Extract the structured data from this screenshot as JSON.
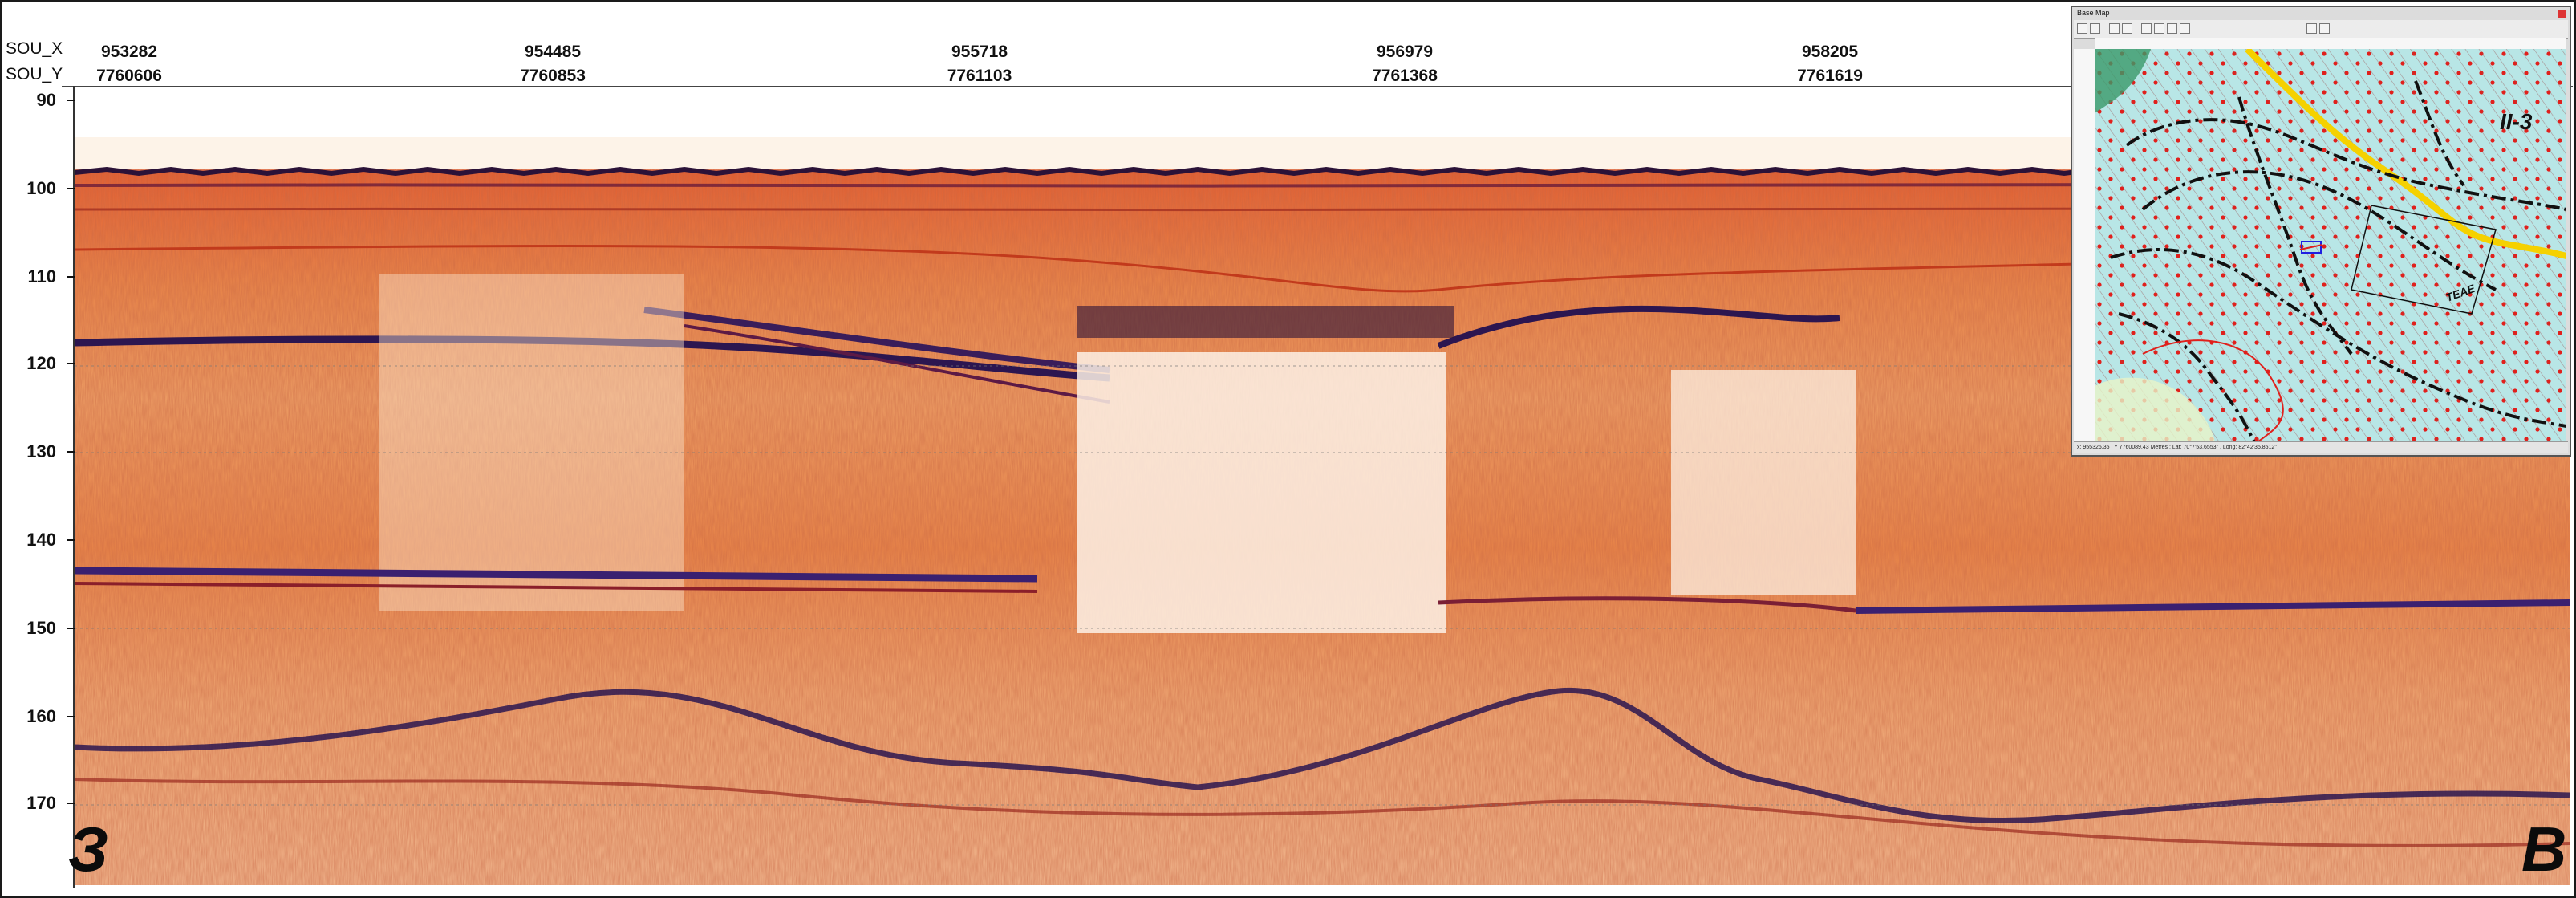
{
  "header": {
    "x_label": "SOU_X",
    "y_label": "SOU_Y",
    "coords": [
      {
        "x": "953282",
        "y": "7760606"
      },
      {
        "x": "954485",
        "y": "7760853"
      },
      {
        "x": "955718",
        "y": "7761103"
      },
      {
        "x": "956979",
        "y": "7761368"
      },
      {
        "x": "958205",
        "y": "7761619"
      }
    ]
  },
  "depth_axis": {
    "ticks": [
      "90",
      "100",
      "110",
      "120",
      "130",
      "140",
      "150",
      "160",
      "170"
    ]
  },
  "panel_labels": {
    "left": "З",
    "right": "В"
  },
  "inset": {
    "title": "Base Map",
    "map_label_1": "II-3",
    "map_label_2": "ТЕАЕ",
    "status": "x: 955326.35 , Y 7760089.43 Metres ; Lat: 70°7'53.6553\" , Long: 82°42'35.8512\""
  },
  "colors": {
    "seismic_light": "#fbe8d4",
    "seismic_mid": "#f08c3c",
    "seismic_dark": "#c2391b",
    "seismic_deep": "#3a1d5a",
    "map_water": "#b8e6e6",
    "map_fault": "#111111",
    "map_highlight": "#f5d100",
    "map_points": "#e0201c"
  }
}
